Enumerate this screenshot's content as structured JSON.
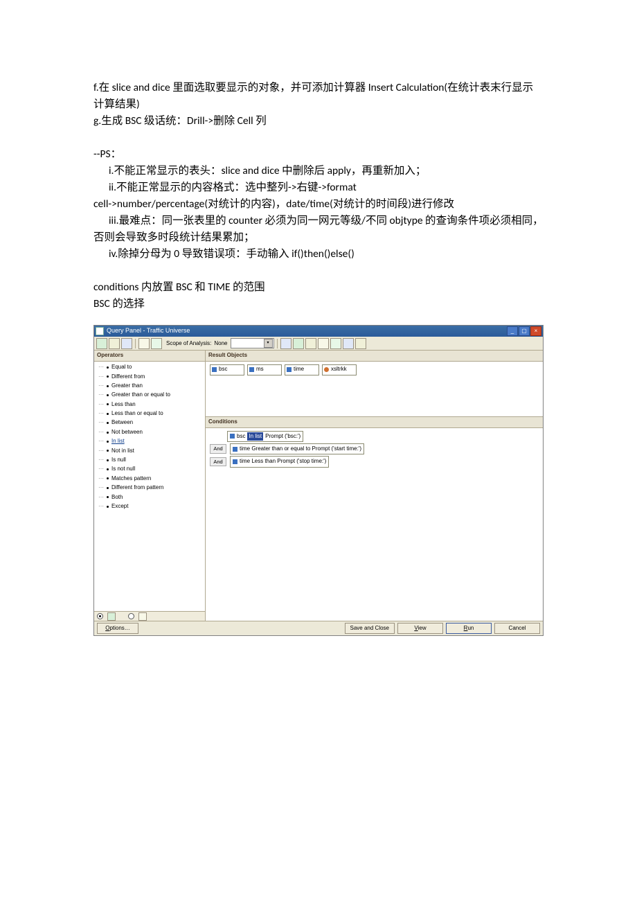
{
  "doc": {
    "p1": "f.在 slice and dice 里面选取要显示的对象，并可添加计算器 Insert Calculation(在统计表末行显示计算结果)",
    "p2": "g.生成 BSC 级话统：Drill->删除 Cell 列",
    "p3": "--PS：",
    "p4": "i.不能正常显示的表头：slice and dice 中删除后 apply，再重新加入；",
    "p5": "ii.不能正常显示的内容格式：选中整列->右键->format",
    "p6": "cell->number/percentage(对统计的内容)，date/time(对统计的时间段)进行修改",
    "p7": "iii.最难点：同一张表里的 counter 必须为同一网元等级/不同 objtype 的查询条件项必须相同，否则会导致多时段统计结果累加；",
    "p8": "iv.除掉分母为 0 导致错误项：手动输入 if()then()else()",
    "p9": "conditions 内放置 BSC 和 TIME 的范围",
    "p10": "BSC 的选择"
  },
  "screenshot": {
    "title": "Query Panel - Traffic Universe",
    "toolbar": {
      "scope_label": "Scope of Analysis:",
      "scope_value": "None"
    },
    "left": {
      "header": "Operators",
      "ops": [
        "Equal to",
        "Different from",
        "Greater than",
        "Greater than or equal to",
        "Less than",
        "Less than or equal to",
        "Between",
        "Not between",
        "In list",
        "Not in list",
        "Is null",
        "Is not null",
        "Matches pattern",
        "Different from pattern",
        "Both",
        "Except"
      ],
      "selected_index": 8
    },
    "result": {
      "header": "Result Objects",
      "objs": [
        "bsc",
        "ms",
        "time",
        "xsltrkk"
      ]
    },
    "cond": {
      "header": "Conditions",
      "and": "And",
      "c1a": "bsc",
      "c1b": "In list",
      "c1c": "Prompt ('bsc:')",
      "c2a": "time Greater than or equal to Prompt ('start time:')",
      "c3a": "time Less than Prompt ('stop time:')"
    },
    "bottom": {
      "options_m": "O",
      "options_rest": "ptions…",
      "save_close": "Save and Close",
      "view_m": "V",
      "view_rest": "iew",
      "run_m": "R",
      "run_rest": "un",
      "cancel": "Cancel"
    }
  }
}
